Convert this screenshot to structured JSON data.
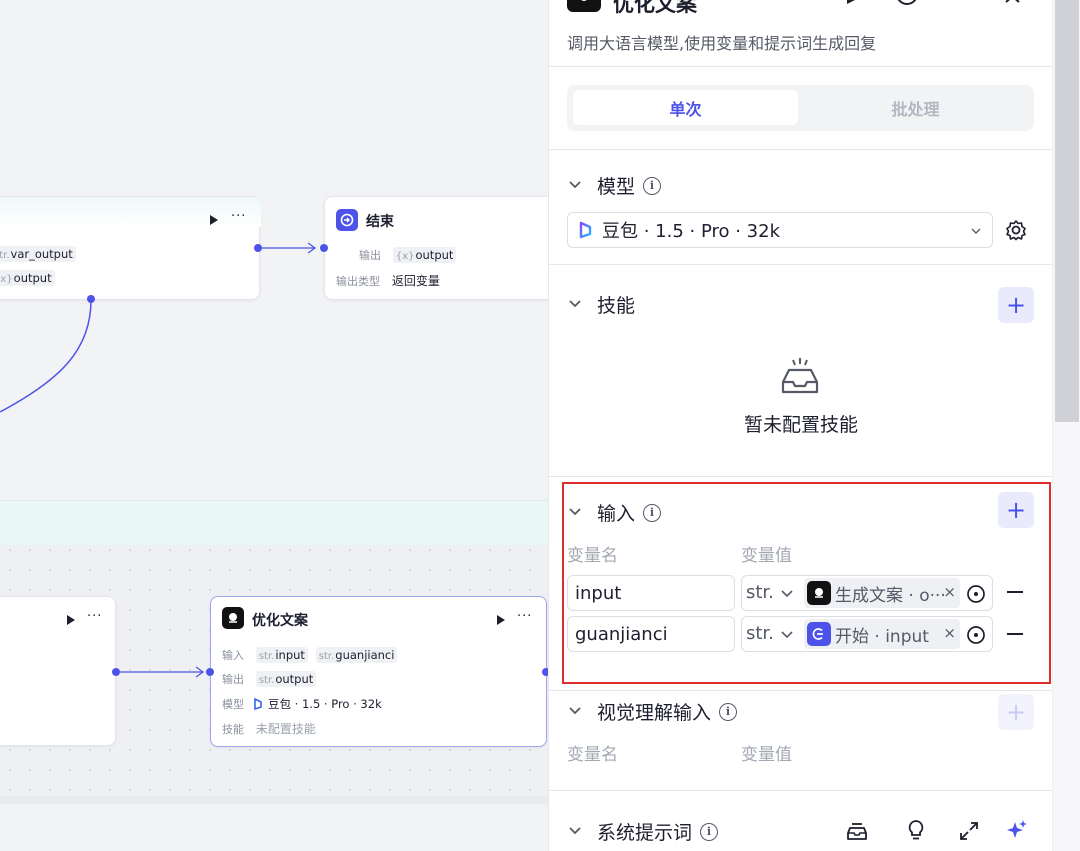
{
  "canvas": {
    "node_upper": {
      "tag1_prefix": "str.",
      "tag1_name": "var_output",
      "tag2_prefix": "{x}",
      "tag2_name": "output"
    },
    "end_node": {
      "title": "结束",
      "output_label": "输出",
      "output_tag_prefix": "{x}",
      "output_tag_name": "output",
      "output_type_label": "输出类型",
      "output_type_value": "返回变量"
    },
    "optimize_node": {
      "title": "优化文案",
      "input_label": "输入",
      "input_tag1_prefix": "str.",
      "input_tag1_name": "input",
      "input_tag2_prefix": "str.",
      "input_tag2_name": "guanjianci",
      "output_label": "输出",
      "output_tag_prefix": "str.",
      "output_tag_name": "output",
      "model_label": "模型",
      "model_value": "豆包 · 1.5 · Pro · 32k",
      "skill_label": "技能",
      "skill_value": "未配置技能"
    }
  },
  "panel": {
    "title": "优化文案",
    "description": "调用大语言模型,使用变量和提示词生成回复",
    "tabs": [
      {
        "label": "单次",
        "active": true
      },
      {
        "label": "批处理",
        "active": false
      }
    ],
    "model_section": {
      "title": "模型",
      "selected_model": "豆包 · 1.5 · Pro · 32k"
    },
    "skills_section": {
      "title": "技能",
      "empty_text": "暂未配置技能"
    },
    "input_section": {
      "title": "输入",
      "col_name": "变量名",
      "col_value": "变量值",
      "rows": [
        {
          "name": "input",
          "type": "str.",
          "ref": "生成文案 · o···"
        },
        {
          "name": "guanjianci",
          "type": "str.",
          "ref": "开始 · input"
        }
      ]
    },
    "vision_section": {
      "title": "视觉理解输入",
      "col_name": "变量名",
      "col_value": "变量值"
    },
    "system_prompt_section": {
      "title": "系统提示词"
    }
  },
  "colors": {
    "accent": "#4d53e8",
    "highlight_border": "#e02b2b"
  },
  "icons": [
    "run-icon",
    "more-icon",
    "close-icon",
    "info-icon",
    "chevron-down-icon",
    "gear-icon",
    "plus-icon",
    "empty-tray-icon",
    "minus-icon",
    "variable-ref-icon",
    "prompt-library-icon",
    "bulb-icon",
    "expand-icon",
    "sparkle-icon"
  ]
}
